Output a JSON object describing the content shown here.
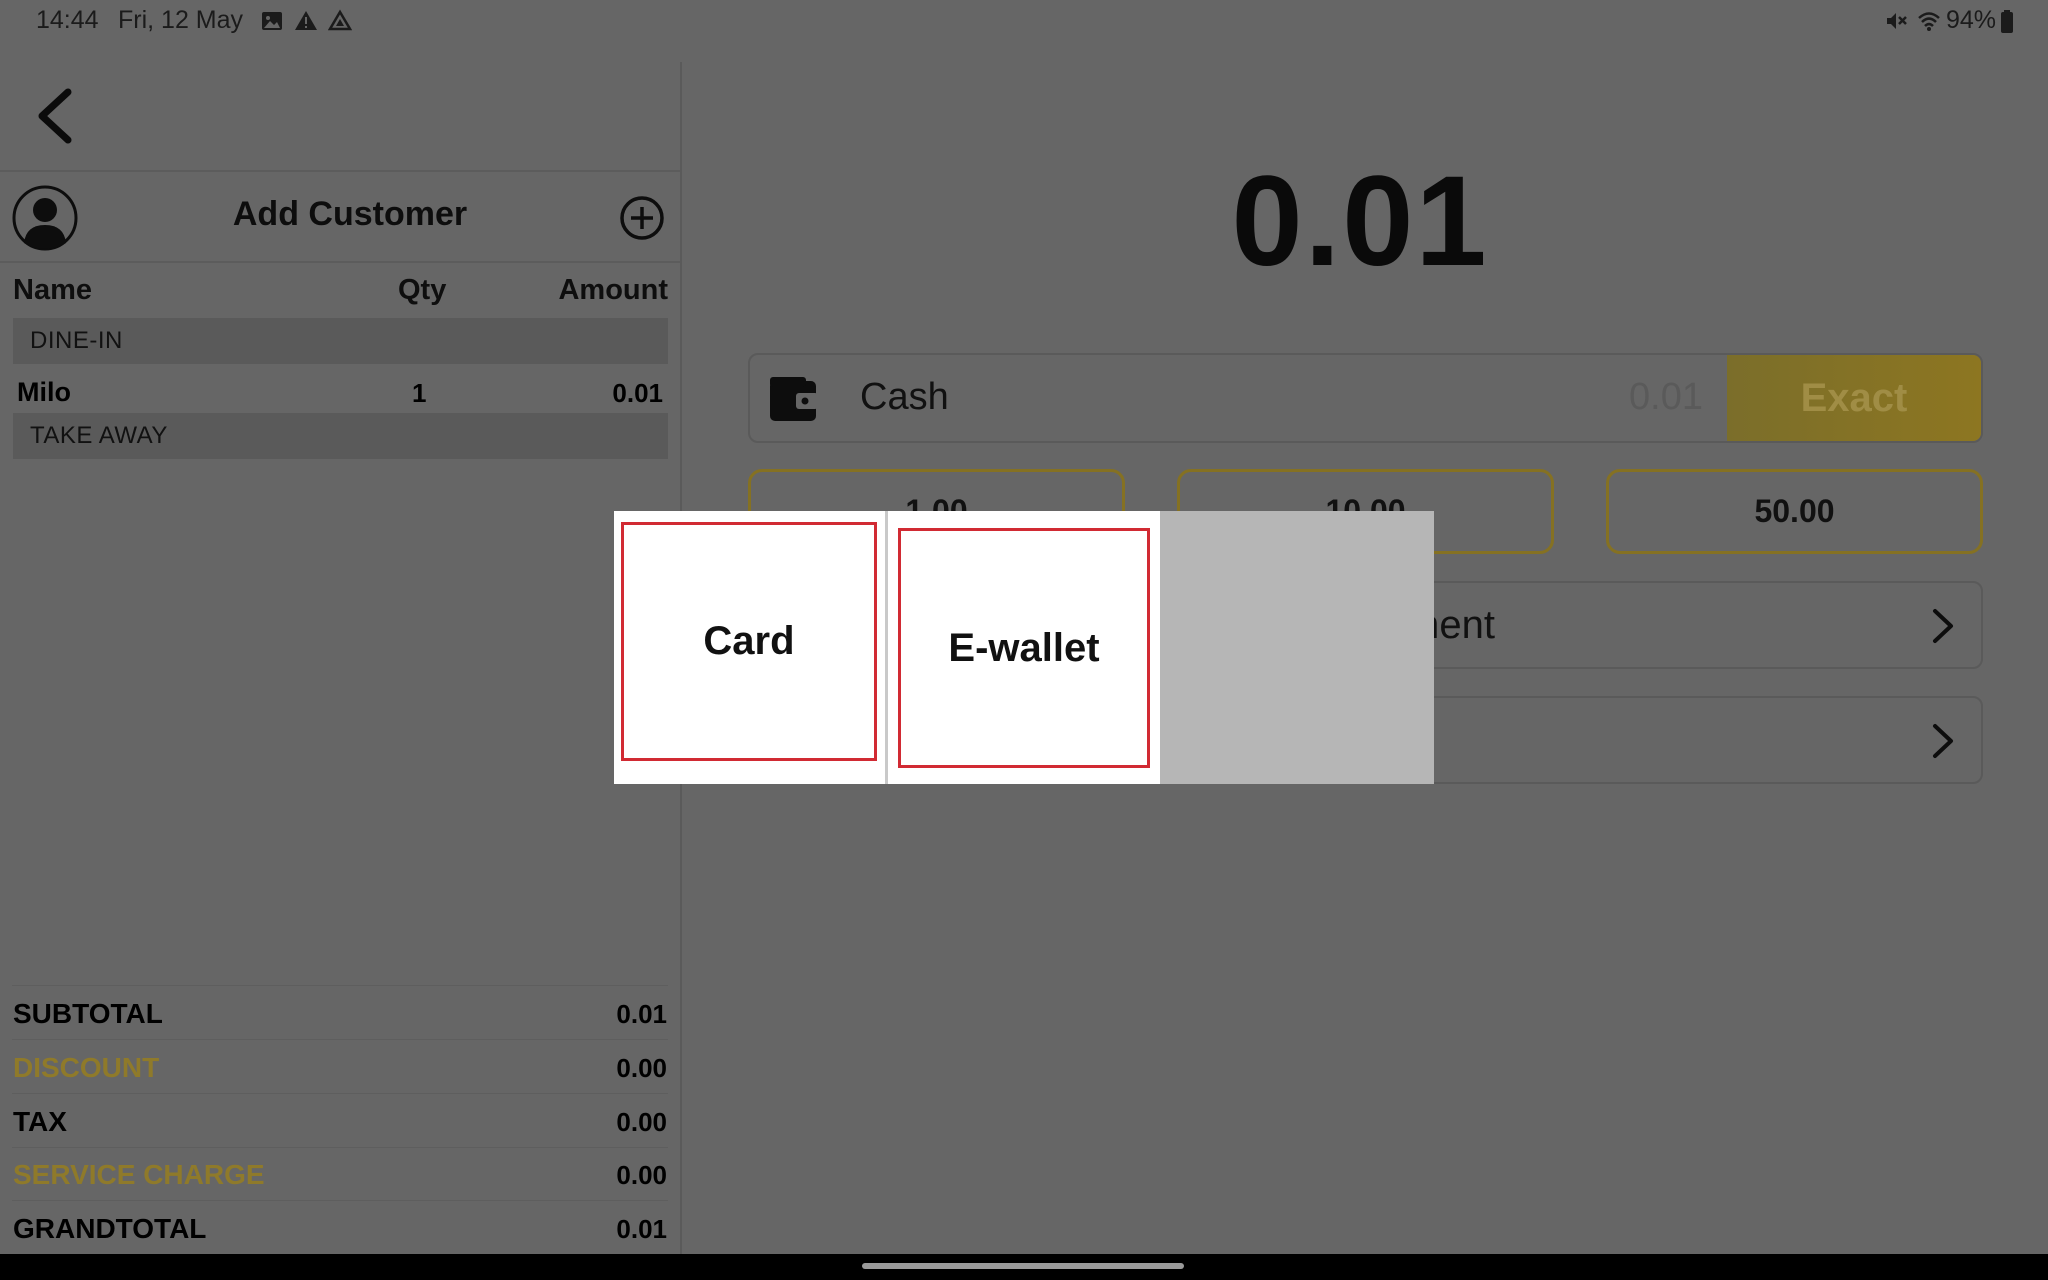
{
  "status_bar": {
    "time": "14:44",
    "date": "Fri, 12 May",
    "battery": "94%",
    "left_icons": [
      "gallery-icon",
      "warning-icon",
      "drive-icon"
    ],
    "right_icons": [
      "mute-icon",
      "wifi-icon",
      "battery-icon"
    ]
  },
  "order": {
    "customer_label": "Add Customer",
    "columns": {
      "name": "Name",
      "qty": "Qty",
      "amount": "Amount"
    },
    "sections": [
      {
        "title": "DINE-IN",
        "items": [
          {
            "name": "Milo",
            "qty": "1",
            "amount": "0.01"
          }
        ]
      },
      {
        "title": "TAKE AWAY",
        "items": []
      }
    ],
    "totals": [
      {
        "label": "SUBTOTAL",
        "value": "0.01",
        "highlight": false
      },
      {
        "label": "DISCOUNT",
        "value": "0.00",
        "highlight": true
      },
      {
        "label": "TAX",
        "value": "0.00",
        "highlight": false
      },
      {
        "label": "SERVICE CHARGE",
        "value": "0.00",
        "highlight": true
      },
      {
        "label": "GRANDTOTAL",
        "value": "0.01",
        "highlight": false
      }
    ]
  },
  "payment": {
    "amount_due": "0.01",
    "cash": {
      "label": "Cash",
      "placeholder": "0.01",
      "exact_label": "Exact"
    },
    "quick_amounts": [
      "1.00",
      "10.00",
      "50.00"
    ],
    "rows": [
      {
        "label": "ment"
      },
      {
        "label": ""
      }
    ]
  },
  "modal": {
    "options": [
      "Card",
      "E-wallet"
    ]
  },
  "colors": {
    "accent_gold": "#a0821f",
    "highlight_text": "#8f7a2a",
    "modal_border": "#d12a33"
  }
}
